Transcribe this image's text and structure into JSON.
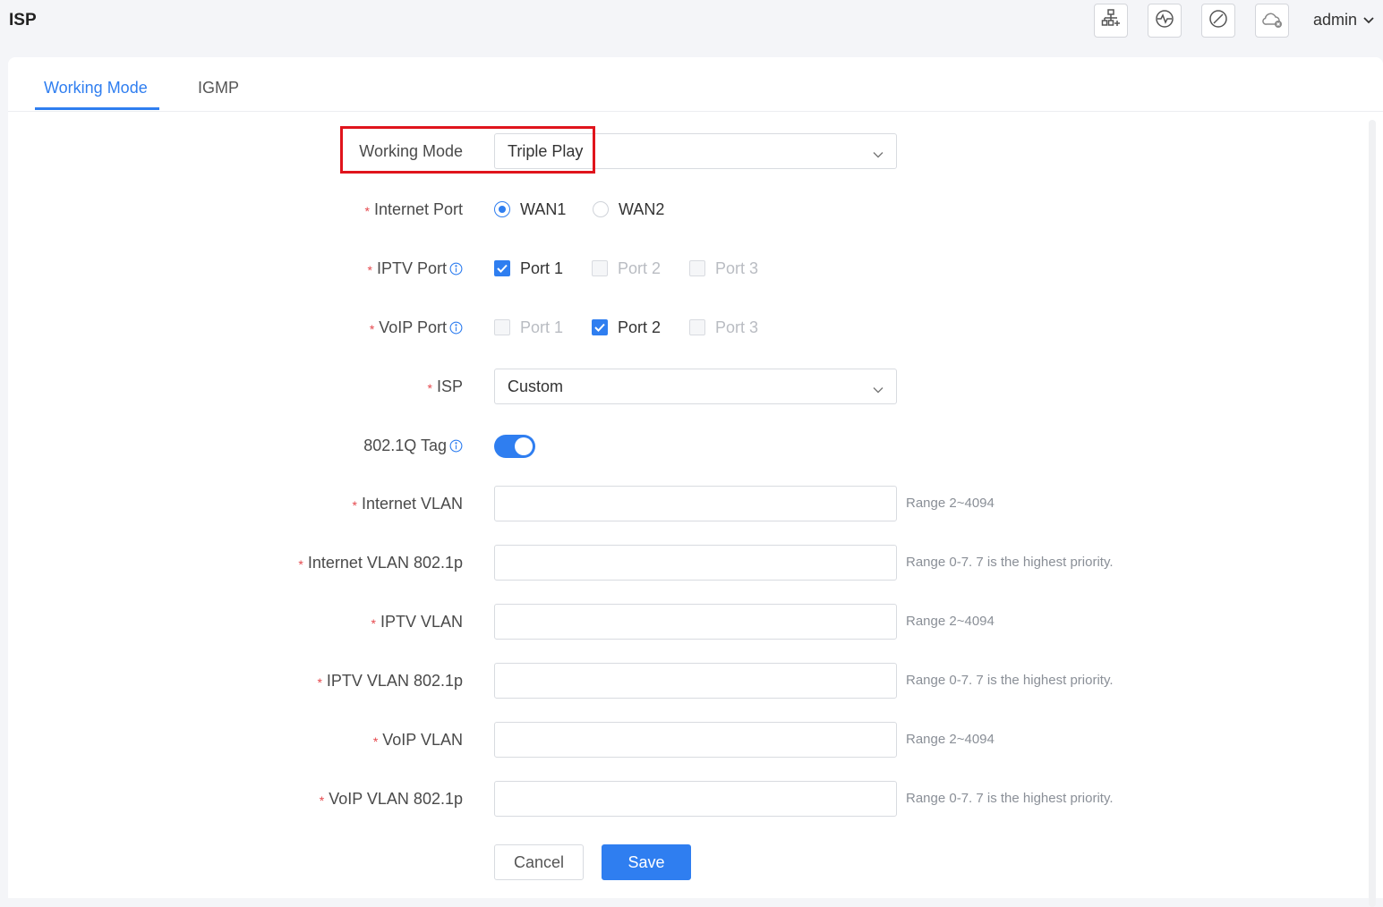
{
  "header": {
    "title": "ISP",
    "user": "admin",
    "tools": [
      "topology-icon",
      "diagnostics-icon",
      "disable-icon",
      "cloud-offline-icon"
    ]
  },
  "tabs": [
    {
      "label": "Working Mode",
      "active": true
    },
    {
      "label": "IGMP",
      "active": false
    }
  ],
  "form": {
    "working_mode": {
      "label": "Working Mode",
      "value": "Triple Play"
    },
    "internet_port": {
      "label": "Internet Port",
      "options": [
        {
          "label": "WAN1",
          "selected": true
        },
        {
          "label": "WAN2",
          "selected": false
        }
      ]
    },
    "iptv_port": {
      "label": "IPTV Port",
      "options": [
        {
          "label": "Port 1",
          "checked": true,
          "disabled": false
        },
        {
          "label": "Port 2",
          "checked": false,
          "disabled": true
        },
        {
          "label": "Port 3",
          "checked": false,
          "disabled": true
        }
      ]
    },
    "voip_port": {
      "label": "VoIP Port",
      "options": [
        {
          "label": "Port 1",
          "checked": false,
          "disabled": true
        },
        {
          "label": "Port 2",
          "checked": true,
          "disabled": false
        },
        {
          "label": "Port 3",
          "checked": false,
          "disabled": true
        }
      ]
    },
    "isp": {
      "label": "ISP",
      "value": "Custom"
    },
    "tag_8021q": {
      "label": "802.1Q Tag",
      "enabled": true
    },
    "internet_vlan": {
      "label": "Internet VLAN",
      "value": "",
      "hint": "Range 2~4094"
    },
    "internet_vlan_p": {
      "label": "Internet VLAN 802.1p",
      "value": "",
      "hint": "Range 0-7. 7 is the highest priority."
    },
    "iptv_vlan": {
      "label": "IPTV VLAN",
      "value": "",
      "hint": "Range 2~4094"
    },
    "iptv_vlan_p": {
      "label": "IPTV VLAN 802.1p",
      "value": "",
      "hint": "Range 0-7. 7 is the highest priority."
    },
    "voip_vlan": {
      "label": "VoIP VLAN",
      "value": "",
      "hint": "Range 2~4094"
    },
    "voip_vlan_p": {
      "label": "VoIP VLAN 802.1p",
      "value": "",
      "hint": "Range 0-7. 7 is the highest priority."
    }
  },
  "buttons": {
    "cancel": "Cancel",
    "save": "Save"
  },
  "colors": {
    "accent": "#2f7ef0",
    "required": "#e5484d",
    "highlight_box": "#e0141c"
  }
}
